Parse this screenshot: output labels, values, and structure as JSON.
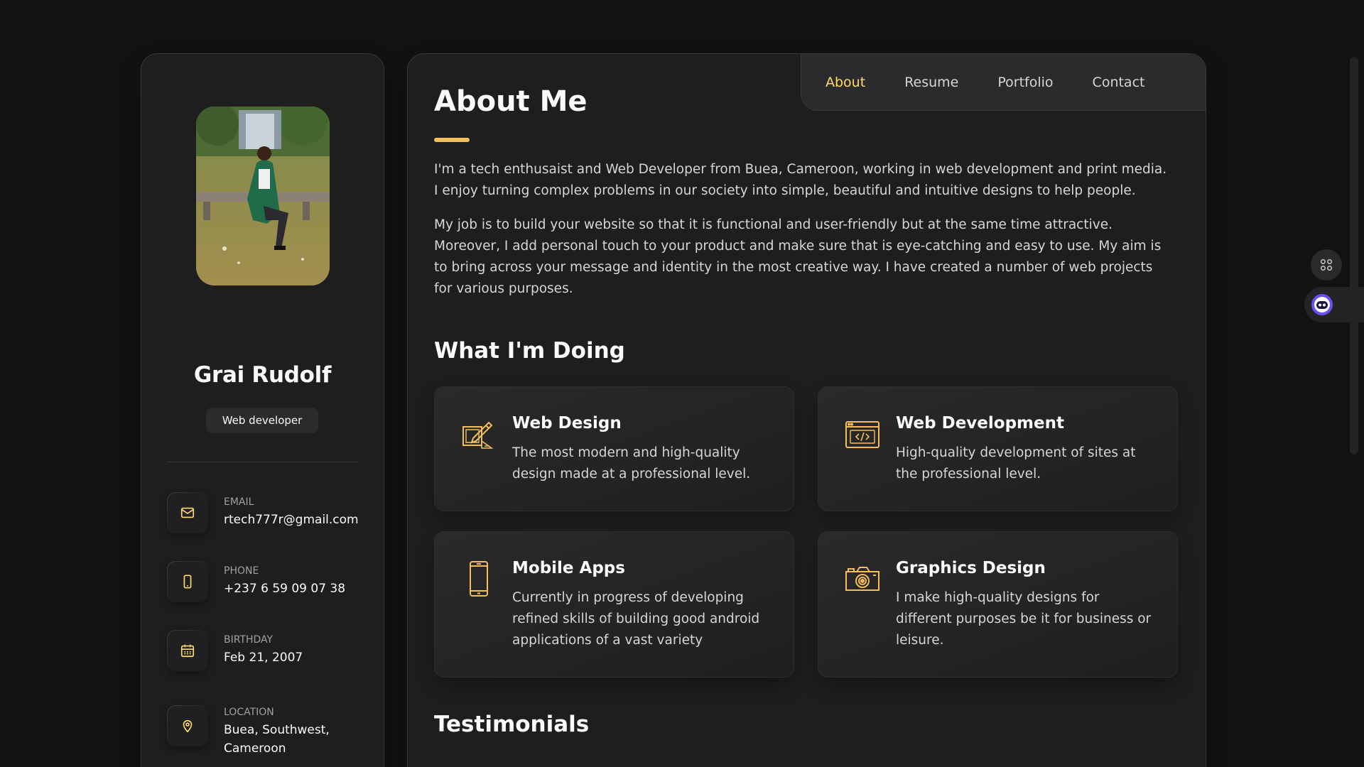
{
  "sidebar": {
    "name": "Grai Rudolf",
    "title": "Web developer",
    "contacts": [
      {
        "label": "Email",
        "value": "rtech777r@gmail.com",
        "icon": "mail-icon"
      },
      {
        "label": "Phone",
        "value": "+237 6 59 09 07 38",
        "icon": "phone-icon"
      },
      {
        "label": "Birthday",
        "value": "Feb 21, 2007",
        "icon": "calendar-icon"
      },
      {
        "label": "Location",
        "value": "Buea, Southwest, Cameroon",
        "icon": "location-pin-icon"
      }
    ],
    "socials": [
      "facebook-icon",
      "twitter-icon",
      "instagram-icon"
    ]
  },
  "nav": {
    "items": [
      "About",
      "Resume",
      "Portfolio",
      "Contact"
    ],
    "active": "About"
  },
  "about": {
    "heading": "About Me",
    "paragraphs": [
      "I'm a tech enthusaist and Web Developer from Buea, Cameroon, working in web development and print media. I enjoy turning complex problems in our society into simple, beautiful and intuitive designs to help people.",
      "My job is to build your website so that it is functional and user-friendly but at the same time attractive. Moreover, I add personal touch to your product and make sure that is eye-catching and easy to use. My aim is to bring across your message and identity in the most creative way. I have created a number of web projects for various purposes."
    ]
  },
  "services": {
    "heading": "What I'm Doing",
    "items": [
      {
        "title": "Web Design",
        "text": "The most modern and high-quality design made at a professional level.",
        "icon": "design-icon"
      },
      {
        "title": "Web Development",
        "text": "High-quality development of sites at the professional level.",
        "icon": "code-window-icon"
      },
      {
        "title": "Mobile Apps",
        "text": "Currently in progress of developing refined skills of building good android applications of a vast variety",
        "icon": "mobile-icon"
      },
      {
        "title": "Graphics Design",
        "text": "I make high-quality designs for different purposes be it for business or leisure.",
        "icon": "camera-icon"
      }
    ]
  },
  "testimonials": {
    "heading": "Testimonials"
  },
  "colors": {
    "accent": "#ffdb70",
    "background": "#121212",
    "card": "#1e1e1f"
  }
}
